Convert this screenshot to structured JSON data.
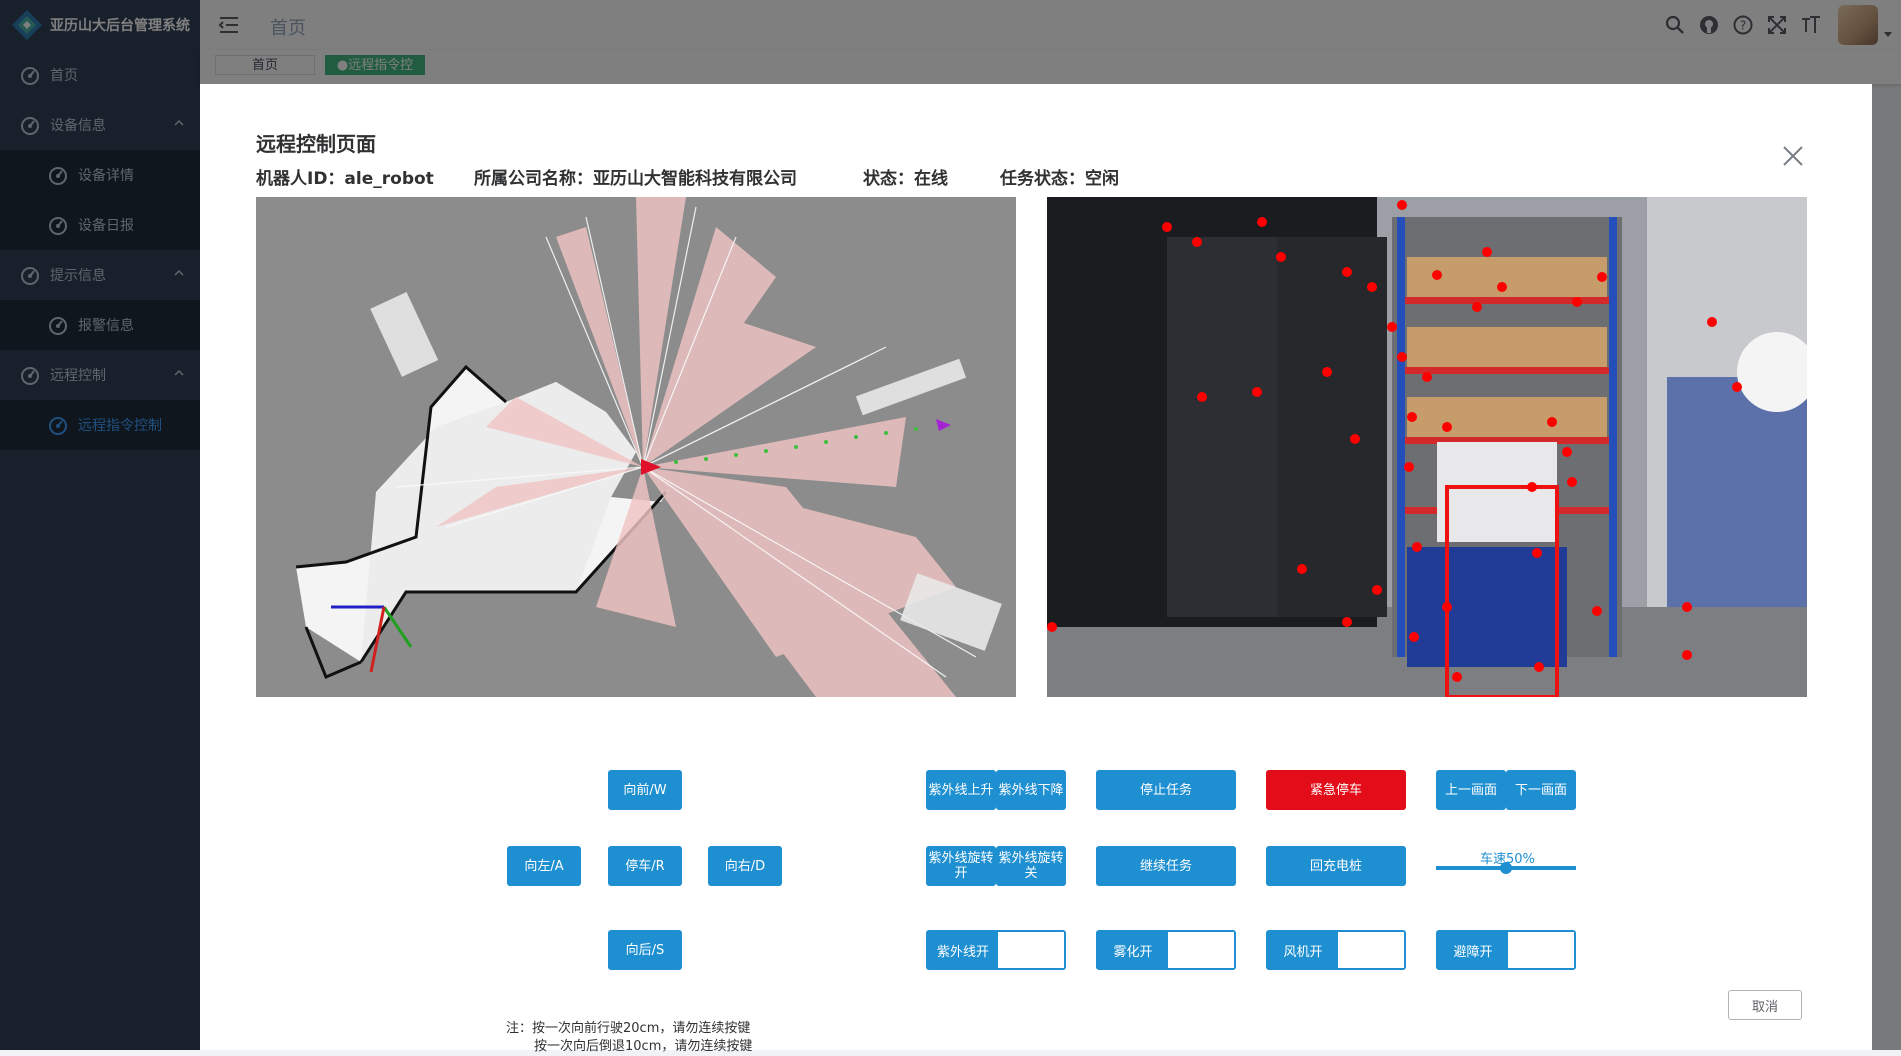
{
  "app": {
    "title": "亚历山大后台管理系统"
  },
  "sidebar": {
    "items": [
      {
        "label": "首页"
      },
      {
        "label": "设备信息"
      },
      {
        "label": "设备详情"
      },
      {
        "label": "设备日报"
      },
      {
        "label": "提示信息"
      },
      {
        "label": "报警信息"
      },
      {
        "label": "远程控制"
      },
      {
        "label": "远程指令控制"
      }
    ]
  },
  "header": {
    "breadcrumb": "首页"
  },
  "tags": {
    "home": "首页",
    "current": "●远程指令控制"
  },
  "dialog": {
    "title": "远程控制页面",
    "robot_id": "机器人ID：ale_robot",
    "company": "所属公司名称：亚历山大智能科技有限公司",
    "status": "状态：在线",
    "task_status": "任务状态：空闲"
  },
  "controls": {
    "forward": "向前/W",
    "left": "向左/A",
    "stop": "停车/R",
    "right": "向右/D",
    "back": "向后/S",
    "uv_up": "紫外线上升",
    "uv_down": "紫外线下降",
    "uv_rot_on": "紫外线旋转开",
    "uv_rot_off": "紫外线旋转关",
    "uv_toggle": "紫外线开",
    "stop_task": "停止任务",
    "continue_task": "继续任务",
    "mist_toggle": "雾化开",
    "emergency_stop": "紧急停车",
    "recharge": "回充电桩",
    "fan_toggle": "风机开",
    "prev_screen": "上一画面",
    "next_screen": "下一画面",
    "speed_label": "车速50%",
    "speed_value": 0.5,
    "avoid_toggle": "避障开",
    "cancel": "取消"
  },
  "note": {
    "line1": "注：按一次向前行驶20cm，请勿连续按键",
    "line2": "按一次向后倒退10cm，请勿连续按键"
  },
  "colors": {
    "primary": "#1e8fd1",
    "danger": "#e20d18",
    "sidebar": "#304156",
    "active_tag": "#42b983"
  }
}
